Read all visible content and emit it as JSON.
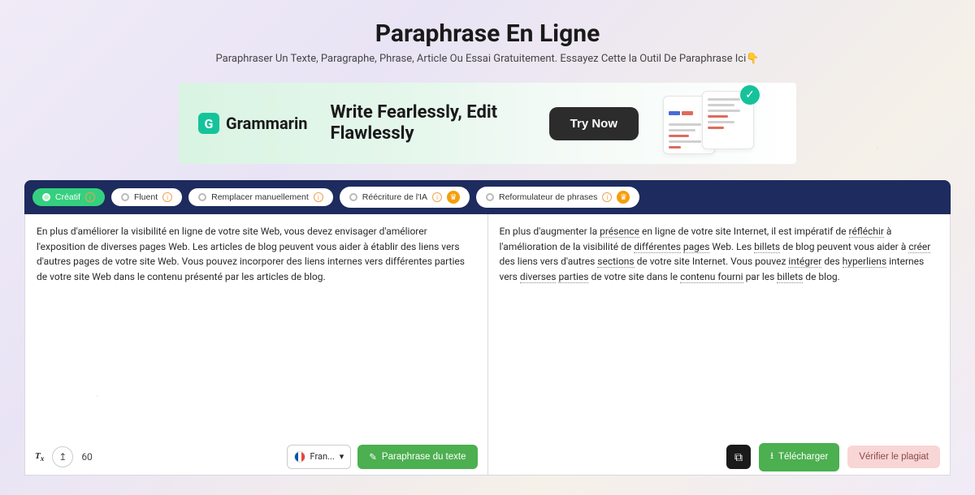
{
  "header": {
    "title": "Paraphrase En Ligne",
    "subtitle": "Paraphraser Un Texte, Paragraphe, Phrase, Article Ou Essai Gratuitement. Essayez Cette la Outil De Paraphrase Ici",
    "pointer": "👇"
  },
  "ad": {
    "logo_text": "Grammarin",
    "headline": "Write Fearlessly, Edit Flawlessly",
    "cta": "Try Now"
  },
  "tabs": [
    {
      "label": "Créatif",
      "active": true,
      "info": true,
      "pro": false
    },
    {
      "label": "Fluent",
      "active": false,
      "info": true,
      "pro": false
    },
    {
      "label": "Remplacer manuellement",
      "active": false,
      "info": true,
      "pro": false
    },
    {
      "label": "Réécriture de l'IA",
      "active": false,
      "info": true,
      "pro": true
    },
    {
      "label": "Reformulateur de phrases",
      "active": false,
      "info": true,
      "pro": true
    }
  ],
  "input": {
    "text": "En plus d'améliorer la visibilité en ligne de votre site Web, vous devez envisager d'améliorer l'exposition de diverses pages Web. Les articles de blog peuvent vous aider à établir des liens vers d'autres pages de votre site Web. Vous pouvez incorporer des liens internes vers différentes parties de votre site Web dans le contenu présenté par les articles de blog.",
    "word_count": "60",
    "language": "Fran...",
    "paraphrase_btn": "Paraphrase du texte"
  },
  "output": {
    "segments": [
      {
        "t": "En plus d'augmenter la ",
        "u": false
      },
      {
        "t": "présence",
        "u": true
      },
      {
        "t": " en ligne de votre site Internet, il est impératif de ",
        "u": false
      },
      {
        "t": "réfléchir",
        "u": true
      },
      {
        "t": " à l'amélioration de la visibilité de ",
        "u": false
      },
      {
        "t": "différentes",
        "u": true
      },
      {
        "t": " ",
        "u": false
      },
      {
        "t": "pages",
        "u": true
      },
      {
        "t": " Web. Les ",
        "u": false
      },
      {
        "t": "billets",
        "u": true
      },
      {
        "t": " de blog peuvent vous aider à ",
        "u": false
      },
      {
        "t": "créer",
        "u": true
      },
      {
        "t": " des liens vers d'autres ",
        "u": false
      },
      {
        "t": "sections",
        "u": true
      },
      {
        "t": " de votre site Internet. Vous pouvez ",
        "u": false
      },
      {
        "t": "intégrer",
        "u": true
      },
      {
        "t": " des ",
        "u": false
      },
      {
        "t": "hyperliens",
        "u": true
      },
      {
        "t": " internes vers ",
        "u": false
      },
      {
        "t": "diverses",
        "u": true
      },
      {
        "t": " ",
        "u": false
      },
      {
        "t": "parties",
        "u": true
      },
      {
        "t": " de votre site dans le ",
        "u": false
      },
      {
        "t": "contenu fourni",
        "u": true
      },
      {
        "t": " par les ",
        "u": false
      },
      {
        "t": "billets",
        "u": true
      },
      {
        "t": " de blog.",
        "u": false
      }
    ],
    "download_btn": "Télécharger",
    "plagiarism_btn": "Vérifier le plagiat"
  }
}
